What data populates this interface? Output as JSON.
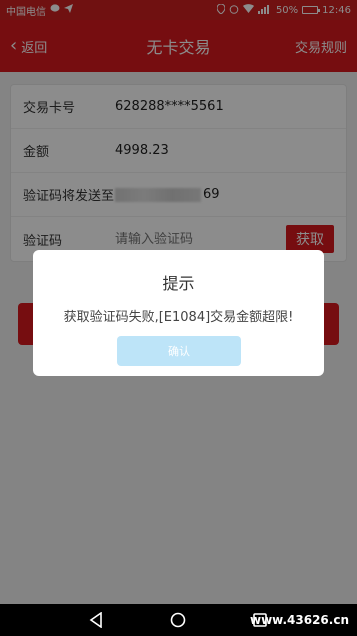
{
  "status_bar": {
    "carrier": "中国电信",
    "battery": "50%",
    "time": "12:46"
  },
  "header": {
    "back_label": "返回",
    "title": "无卡交易",
    "rules_label": "交易规则"
  },
  "form": {
    "card_label": "交易卡号",
    "card_value": "628288****5561",
    "amount_label": "金额",
    "amount_value": "4998.23",
    "sendto_label": "验证码将发送至",
    "sendto_suffix": "69",
    "code_label": "验证码",
    "code_placeholder": "请输入验证码",
    "get_code_label": "获取"
  },
  "dialog": {
    "title": "提示",
    "message": "获取验证码失败,[E1084]交易金额超限!",
    "confirm_label": "确认"
  },
  "watermark": "www.43626.cn"
}
